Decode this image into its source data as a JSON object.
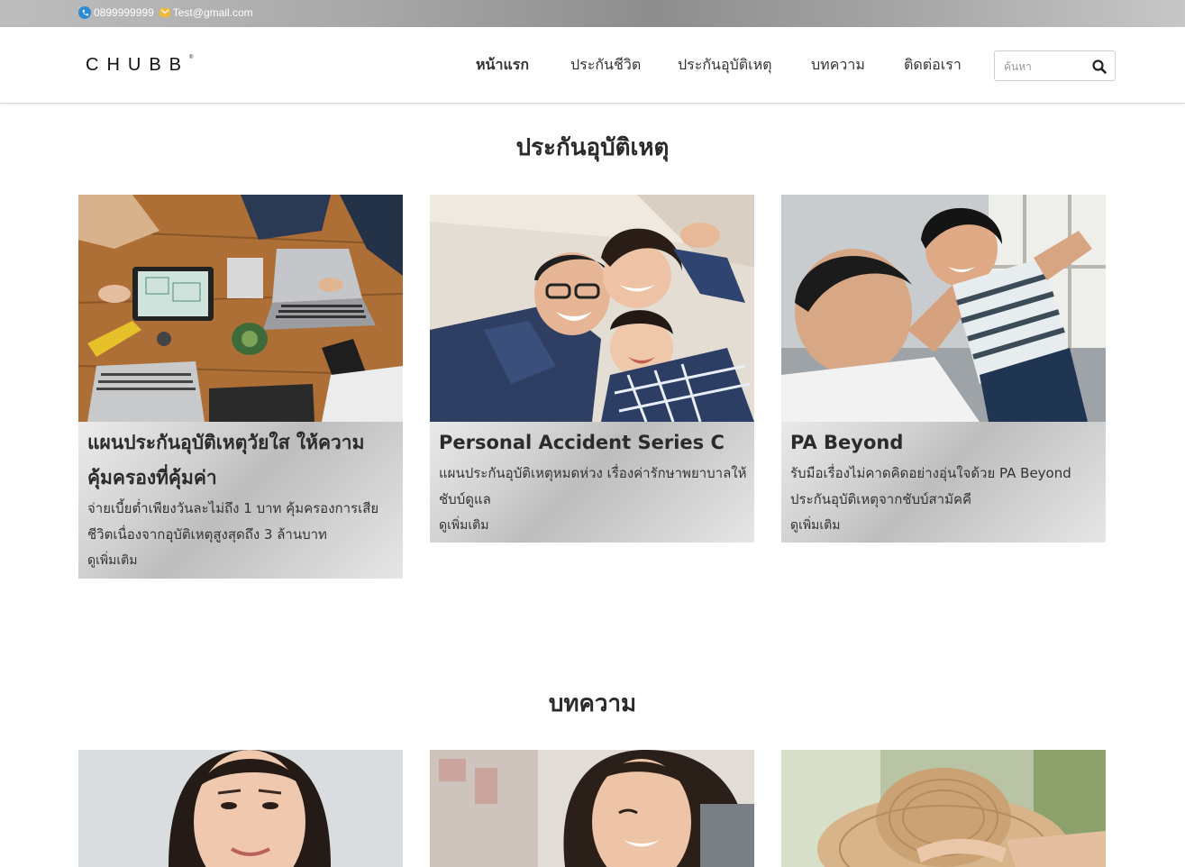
{
  "topbar": {
    "phone": "0899999999",
    "email": "Test@gmail.com",
    "phone_icon": "phone-icon",
    "email_icon": "mail-icon"
  },
  "header": {
    "logo": "CHUBB",
    "logo_mark": "®",
    "nav": [
      "หน้าแรก",
      "ประกันชีวิต",
      "ประกันอุบัติเหตุ",
      "บทความ",
      "ติดต่อเรา"
    ],
    "search_placeholder": "ค้นหา",
    "search_icon": "search-icon"
  },
  "sections": {
    "accident_title": "ประกันอุบัติเหตุ",
    "articles_title": "บทความ"
  },
  "cards": [
    {
      "title": "แผนประกันอุบัติเหตุวัยใส ให้ความคุ้มครองที่คุ้มค่า",
      "desc": "จ่ายเบี้ยต่ำเพียงวันละไม่ถึง 1 บาท คุ้มครองการเสียชีวิตเนื่องจากอุบัติเหตุสูงสุดถึง 3 ล้านบาท",
      "more": "ดูเพิ่มเติม",
      "image": "office-desk-photo"
    },
    {
      "title": "Personal Accident Series C",
      "desc": "แผนประกันอุบัติเหตุหมดห่วง เรื่องค่ารักษาพยาบาลให้ชับบ์ดูแล",
      "more": "ดูเพิ่มเติม",
      "image": "family-photo"
    },
    {
      "title": "PA Beyond",
      "desc": "รับมือเรื่องไม่คาดคิดอย่างอุ่นใจด้วย PA Beyond ประกันอุบัติเหตุจากชับบ์สามัคคี",
      "more": "ดูเพิ่มเติม",
      "image": "father-son-photo"
    }
  ],
  "articles": [
    {
      "image": "woman-portrait-photo"
    },
    {
      "image": "woman-smiling-photo"
    },
    {
      "image": "straw-hat-photo"
    }
  ],
  "colors": {
    "accent": "#2b8bd6",
    "mail": "#f2b83a",
    "text": "#2b2b2b"
  }
}
